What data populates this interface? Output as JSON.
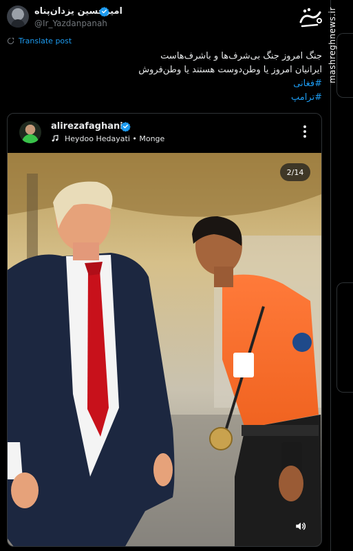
{
  "tweet": {
    "author_name": "امیرحسین یزدان‌پناه",
    "author_handle": "@Ir_Yazdanpanah",
    "translate_label": "Translate post",
    "lines": [
      "جنگ امروز جنگ بی‌شرف‌ها و باشرف‌هاست",
      "ایرانیان امروز یا وطن‌دوست هستند یا وطن‌فروش"
    ],
    "hashtags": [
      "#فغانی",
      "#ترامپ"
    ]
  },
  "embedded_post": {
    "username": "alirezafaghani_",
    "audio": "Heydoo Hedayati • Monge",
    "image_counter": "2/14"
  },
  "watermark": {
    "site": "mashreghnews.ir"
  },
  "colors": {
    "background": "#000000",
    "text": "#e7e9ea",
    "secondary": "#71767b",
    "link": "#1d9bf0",
    "border": "#2f3336"
  },
  "icons": [
    "verified-badge-icon",
    "translate-icon",
    "music-note-icon",
    "more-options-icon",
    "speaker-icon",
    "mashregh-logo-icon"
  ]
}
